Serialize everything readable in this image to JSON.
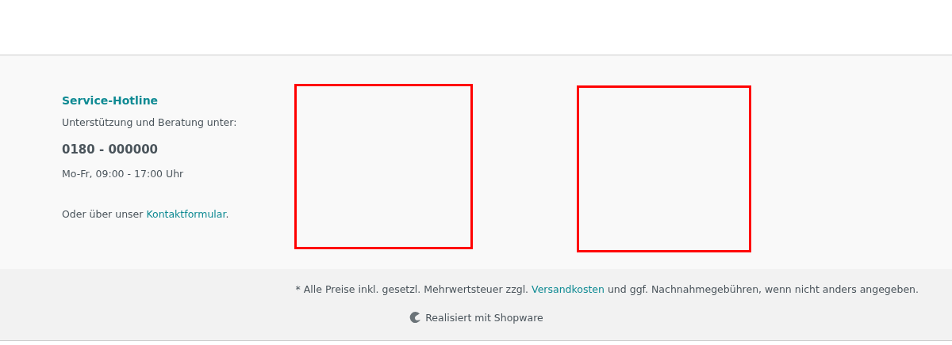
{
  "service": {
    "title": "Service-Hotline",
    "subtitle": "Unterstützung und Beratung unter:",
    "phone": "0180 - 000000",
    "hours": "Mo-Fr, 09:00 - 17:00 Uhr",
    "contact": {
      "before": "Oder über unser ",
      "link": "Kontaktformular",
      "after": "."
    }
  },
  "frames": [
    {
      "kind": "frame"
    },
    {
      "kind": "frame"
    }
  ],
  "bottom": {
    "notice": {
      "before": "* Alle Preise inkl. gesetzl. Mehrwertsteuer zzgl. ",
      "link": "Versandkosten",
      "after": " und ggf. Nachnahmegebühren, wenn nicht anders angegeben."
    },
    "credit": "Realisiert mit Shopware"
  }
}
